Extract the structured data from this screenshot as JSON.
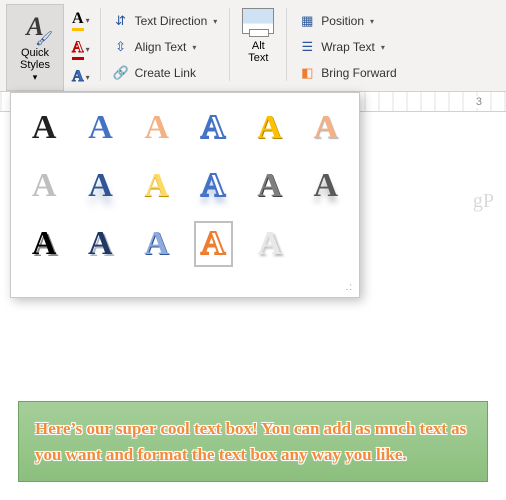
{
  "ribbon": {
    "quick_styles": {
      "label": "Quick Styles"
    },
    "font_fill": "A",
    "font_outline": "A",
    "font_effects": "A",
    "text_direction": "Text Direction",
    "align_text": "Align Text",
    "create_link": "Create Link",
    "alt_text": {
      "line1": "Alt",
      "line2": "Text"
    },
    "position": "Position",
    "wrap_text": "Wrap Text",
    "bring_forward": "Bring Forward"
  },
  "ruler": {
    "mark": "3"
  },
  "watermark": "gP",
  "textbox": {
    "content": "Here’s our super cool text box! You can add as much text as you want and format the text box any way you like."
  },
  "gallery": {
    "glyph": "A",
    "styles": [
      [
        "r1c1",
        "r1c2",
        "r1c3",
        "r1c4",
        "r1c5",
        "r1c6"
      ],
      [
        "r2c1",
        "r2c2",
        "r2c3",
        "r2c4",
        "r2c5",
        "r2c6"
      ],
      [
        "r3c1",
        "r3c2",
        "r3c3",
        "r3c4",
        "r3c5",
        null
      ]
    ],
    "selected": "r3c4"
  }
}
